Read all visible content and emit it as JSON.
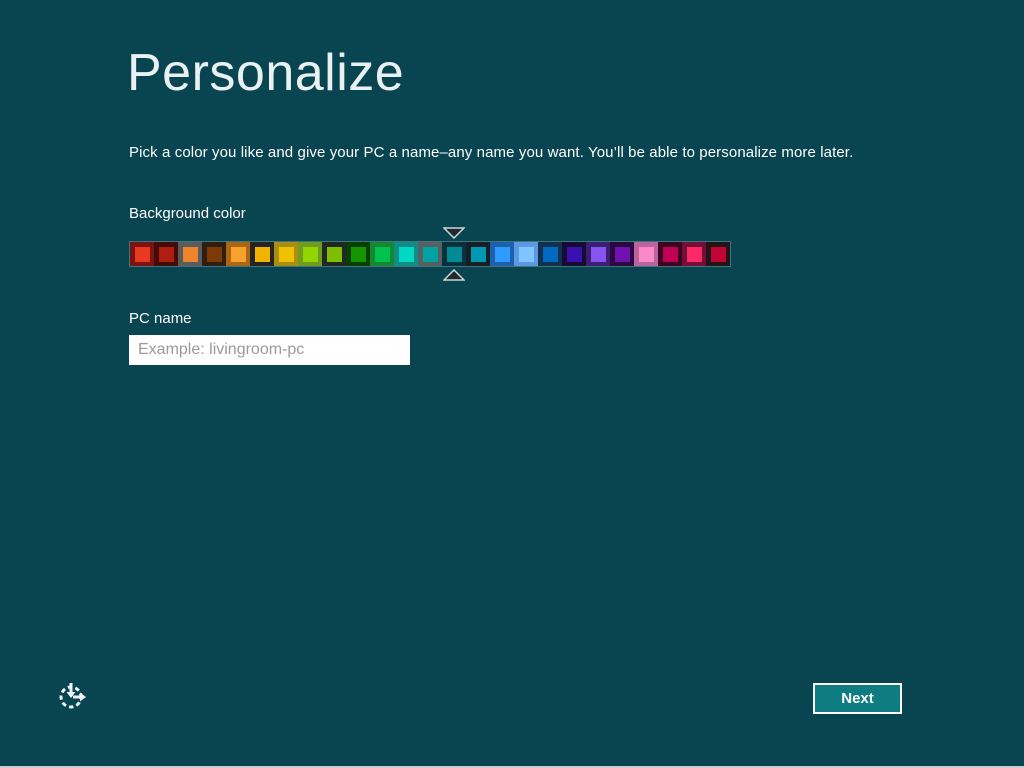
{
  "page": {
    "title": "Personalize",
    "subtitle": "Pick a color you like and give your PC a name–any name you want. You’ll be able to personalize more later.",
    "background_color": "#094550"
  },
  "color_picker": {
    "label": "Background color",
    "selected_index": 13,
    "swatch_count": 25,
    "swatches": [
      {
        "outer": "#7c1511",
        "inner": "#e83a20"
      },
      {
        "outer": "#430c08",
        "inner": "#b01e10"
      },
      {
        "outer": "#5a5b5d",
        "inner": "#f0842d"
      },
      {
        "outer": "#2e1e0f",
        "inner": "#7b3a06"
      },
      {
        "outer": "#aa6614",
        "inner": "#f7a22b"
      },
      {
        "outer": "#242424",
        "inner": "#f2b200"
      },
      {
        "outer": "#a98e12",
        "inner": "#eec200"
      },
      {
        "outer": "#6f9c1e",
        "inner": "#93d500"
      },
      {
        "outer": "#222722",
        "inner": "#7dbf00"
      },
      {
        "outer": "#063f00",
        "inner": "#149600"
      },
      {
        "outer": "#158733",
        "inner": "#00c24f"
      },
      {
        "outer": "#0f8c86",
        "inner": "#00d8c6"
      },
      {
        "outer": "#565f62",
        "inner": "#00a2a2"
      },
      {
        "outer": "#07313c",
        "inner": "#008a94"
      },
      {
        "outer": "#171f26",
        "inner": "#0099b4"
      },
      {
        "outer": "#1e5fae",
        "inner": "#2e9bff"
      },
      {
        "outer": "#5b9ae0",
        "inner": "#7fc5ff"
      },
      {
        "outer": "#11314e",
        "inner": "#0069c0"
      },
      {
        "outer": "#160b33",
        "inner": "#3a10b0"
      },
      {
        "outer": "#3a1f72",
        "inner": "#8655f0"
      },
      {
        "outer": "#2a0a3e",
        "inner": "#6f10b0"
      },
      {
        "outer": "#bb639e",
        "inner": "#f98ac6"
      },
      {
        "outer": "#3c0420",
        "inner": "#c00052"
      },
      {
        "outer": "#721038",
        "inner": "#fd2968"
      },
      {
        "outer": "#241418",
        "inner": "#c00434"
      }
    ],
    "marker_fill": "#1e2a2e",
    "marker_stroke": "#ccd8da"
  },
  "pc_name": {
    "label": "PC name",
    "value": "",
    "placeholder": "Example: livingroom-pc"
  },
  "footer": {
    "next_label": "Next",
    "next_button_color": "#0d7d82",
    "ease_of_access_icon": "ease-of-access",
    "icon_color": "#eef4f5"
  }
}
